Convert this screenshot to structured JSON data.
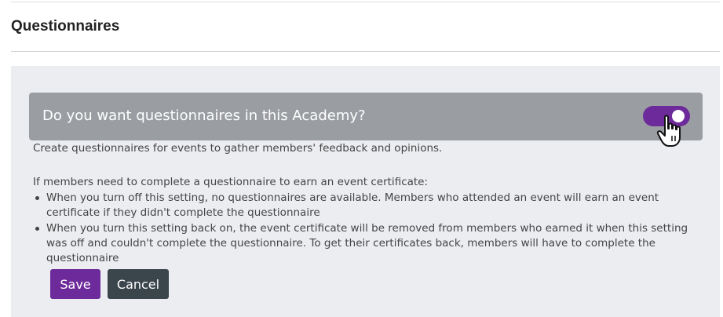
{
  "header": {
    "title": "Questionnaires"
  },
  "setting": {
    "question": "Do you want questionnaires in this Academy?",
    "enabled": true,
    "description": "Create questionnaires for events to gather members' feedback and opinions."
  },
  "rules": {
    "intro": "If members need to complete a questionnaire to earn an event certificate:",
    "items": [
      "When you turn off this setting, no questionnaires are available. Members who attended an event will earn an event certificate if they didn't complete the questionnaire",
      "When you turn this setting back on, the event certificate will be removed from members who earned it when this setting was off and couldn't complete the questionnaire. To get their certificates back, members will have to complete the questionnaire"
    ]
  },
  "actions": {
    "save_label": "Save",
    "cancel_label": "Cancel"
  },
  "colors": {
    "accent": "#6d2a9a",
    "setting_bar": "#9a9ea3",
    "panel_bg": "#ecedf1",
    "cancel_button": "#3a454c"
  },
  "icons": {
    "cursor": "hand-pointer-icon"
  }
}
